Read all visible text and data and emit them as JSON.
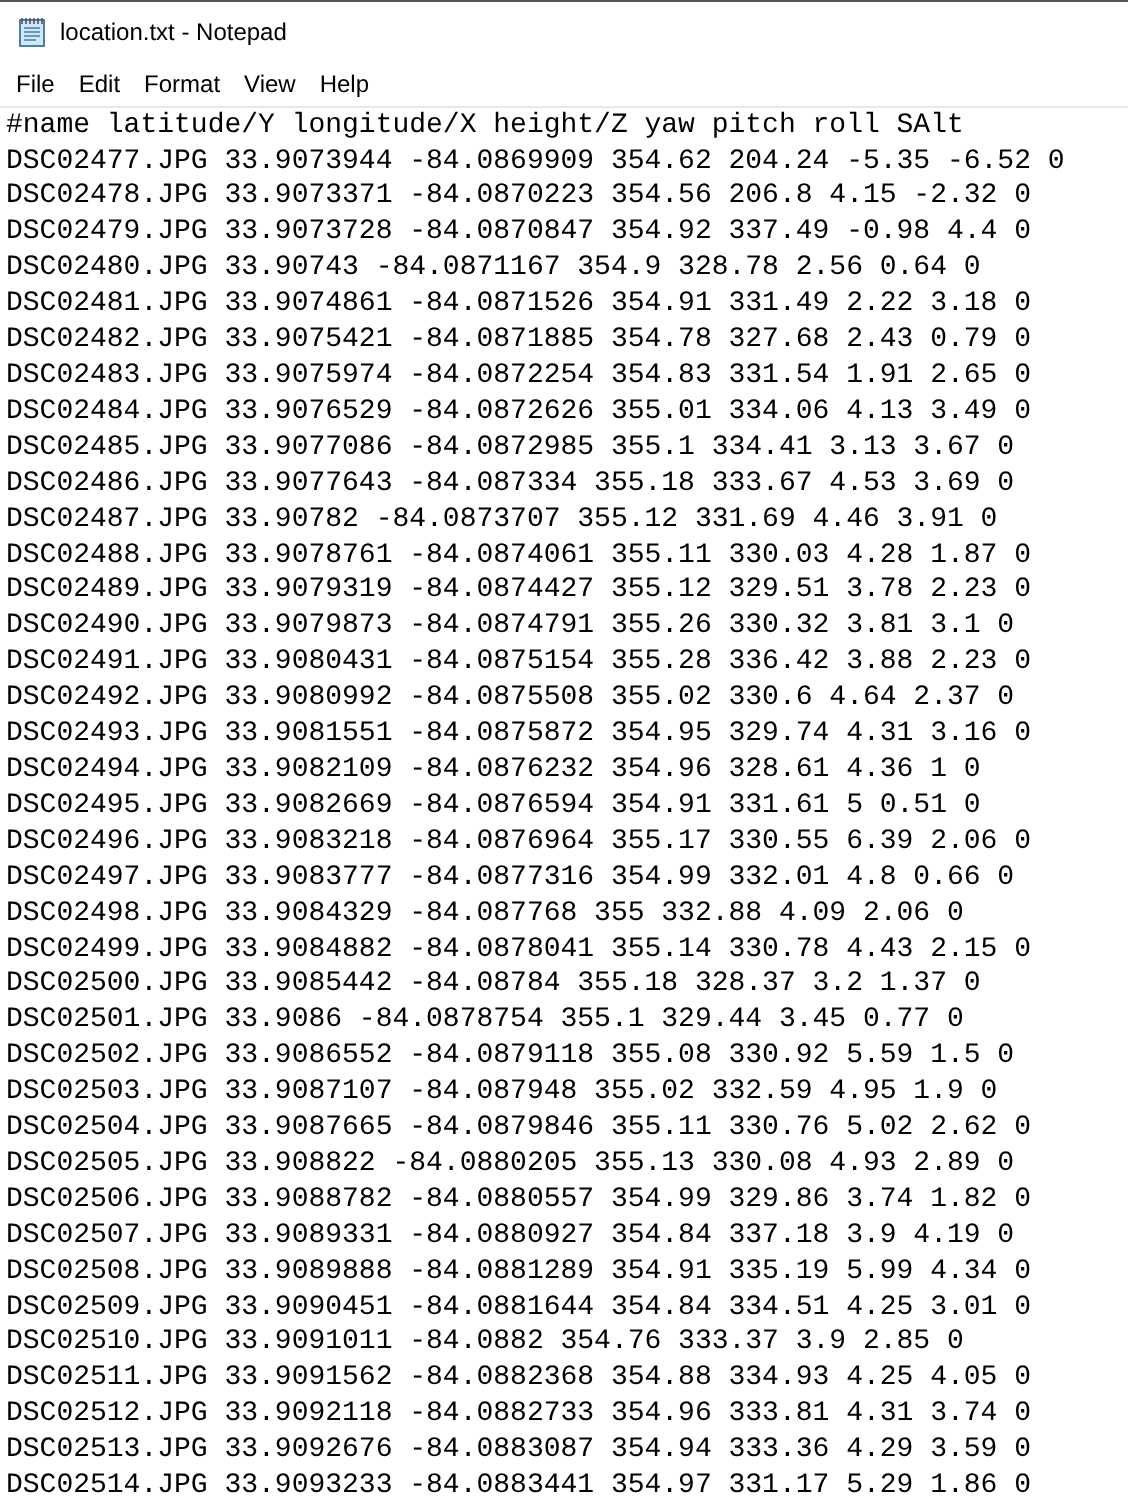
{
  "window": {
    "title": "location.txt - Notepad"
  },
  "menu": [
    "File",
    "Edit",
    "Format",
    "View",
    "Help"
  ],
  "lines": [
    "#name latitude/Y longitude/X height/Z yaw pitch roll SAlt",
    "DSC02477.JPG 33.9073944 -84.0869909 354.62 204.24 -5.35 -6.52 0",
    "DSC02478.JPG 33.9073371 -84.0870223 354.56 206.8 4.15 -2.32 0",
    "DSC02479.JPG 33.9073728 -84.0870847 354.92 337.49 -0.98 4.4 0",
    "DSC02480.JPG 33.90743 -84.0871167 354.9 328.78 2.56 0.64 0",
    "DSC02481.JPG 33.9074861 -84.0871526 354.91 331.49 2.22 3.18 0",
    "DSC02482.JPG 33.9075421 -84.0871885 354.78 327.68 2.43 0.79 0",
    "DSC02483.JPG 33.9075974 -84.0872254 354.83 331.54 1.91 2.65 0",
    "DSC02484.JPG 33.9076529 -84.0872626 355.01 334.06 4.13 3.49 0",
    "DSC02485.JPG 33.9077086 -84.0872985 355.1 334.41 3.13 3.67 0",
    "DSC02486.JPG 33.9077643 -84.087334 355.18 333.67 4.53 3.69 0",
    "DSC02487.JPG 33.90782 -84.0873707 355.12 331.69 4.46 3.91 0",
    "DSC02488.JPG 33.9078761 -84.0874061 355.11 330.03 4.28 1.87 0",
    "DSC02489.JPG 33.9079319 -84.0874427 355.12 329.51 3.78 2.23 0",
    "DSC02490.JPG 33.9079873 -84.0874791 355.26 330.32 3.81 3.1 0",
    "DSC02491.JPG 33.9080431 -84.0875154 355.28 336.42 3.88 2.23 0",
    "DSC02492.JPG 33.9080992 -84.0875508 355.02 330.6 4.64 2.37 0",
    "DSC02493.JPG 33.9081551 -84.0875872 354.95 329.74 4.31 3.16 0",
    "DSC02494.JPG 33.9082109 -84.0876232 354.96 328.61 4.36 1 0",
    "DSC02495.JPG 33.9082669 -84.0876594 354.91 331.61 5 0.51 0",
    "DSC02496.JPG 33.9083218 -84.0876964 355.17 330.55 6.39 2.06 0",
    "DSC02497.JPG 33.9083777 -84.0877316 354.99 332.01 4.8 0.66 0",
    "DSC02498.JPG 33.9084329 -84.087768 355 332.88 4.09 2.06 0",
    "DSC02499.JPG 33.9084882 -84.0878041 355.14 330.78 4.43 2.15 0",
    "DSC02500.JPG 33.9085442 -84.08784 355.18 328.37 3.2 1.37 0",
    "DSC02501.JPG 33.9086 -84.0878754 355.1 329.44 3.45 0.77 0",
    "DSC02502.JPG 33.9086552 -84.0879118 355.08 330.92 5.59 1.5 0",
    "DSC02503.JPG 33.9087107 -84.087948 355.02 332.59 4.95 1.9 0",
    "DSC02504.JPG 33.9087665 -84.0879846 355.11 330.76 5.02 2.62 0",
    "DSC02505.JPG 33.908822 -84.0880205 355.13 330.08 4.93 2.89 0",
    "DSC02506.JPG 33.9088782 -84.0880557 354.99 329.86 3.74 1.82 0",
    "DSC02507.JPG 33.9089331 -84.0880927 354.84 337.18 3.9 4.19 0",
    "DSC02508.JPG 33.9089888 -84.0881289 354.91 335.19 5.99 4.34 0",
    "DSC02509.JPG 33.9090451 -84.0881644 354.84 334.51 4.25 3.01 0",
    "DSC02510.JPG 33.9091011 -84.0882 354.76 333.37 3.9 2.85 0",
    "DSC02511.JPG 33.9091562 -84.0882368 354.88 334.93 4.25 4.05 0",
    "DSC02512.JPG 33.9092118 -84.0882733 354.96 333.81 4.31 3.74 0",
    "DSC02513.JPG 33.9092676 -84.0883087 354.94 333.36 4.29 3.59 0",
    "DSC02514.JPG 33.9093233 -84.0883441 354.97 331.17 5.29 1.86 0"
  ]
}
